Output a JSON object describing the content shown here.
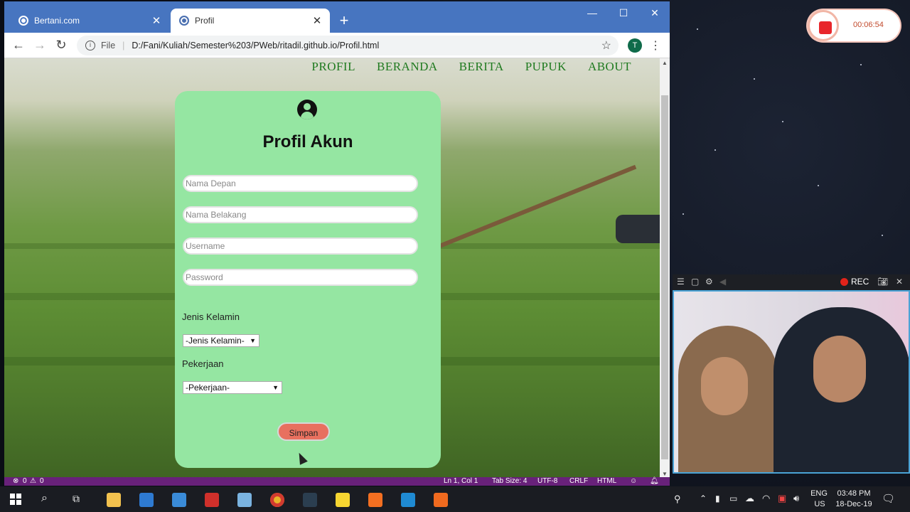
{
  "browser": {
    "tabs": [
      {
        "title": "Bertani.com"
      },
      {
        "title": "Profil"
      }
    ],
    "address": {
      "scheme_label": "File",
      "url": "D:/Fani/Kuliah/Semester%203/PWeb/ritadil.github.io/Profil.html"
    },
    "profile_initial": "T"
  },
  "page": {
    "nav": [
      "PROFIL",
      "BERANDA",
      "BERITA",
      "PUPUK",
      "ABOUT"
    ],
    "form": {
      "title": "Profil Akun",
      "fields": {
        "first_name": "Nama Depan",
        "last_name": "Nama Belakang",
        "username": "Username",
        "password": "Password"
      },
      "gender_label": "Jenis Kelamin",
      "gender_selected": "-Jenis Kelamin-",
      "job_label": "Pekerjaan",
      "job_selected": "-Pekerjaan-",
      "submit": "Simpan"
    }
  },
  "editor_status": {
    "problems": "0",
    "warnings": "0",
    "position": "Ln 1, Col 1",
    "tab_size": "Tab Size: 4",
    "encoding": "UTF-8",
    "eol": "CRLF",
    "language": "HTML"
  },
  "recorder": {
    "elapsed": "00:06:54"
  },
  "camera": {
    "rec_label": "REC"
  },
  "taskbar": {
    "lang": "ENG",
    "region": "US",
    "time": "03:48 PM",
    "date": "18-Dec-19"
  },
  "colors": {
    "card": "#95e6a2",
    "nav_link": "#1f7a1f",
    "submit_button": "#e8705f",
    "tabstrip": "#4775c0",
    "statusbar": "#68217a"
  }
}
